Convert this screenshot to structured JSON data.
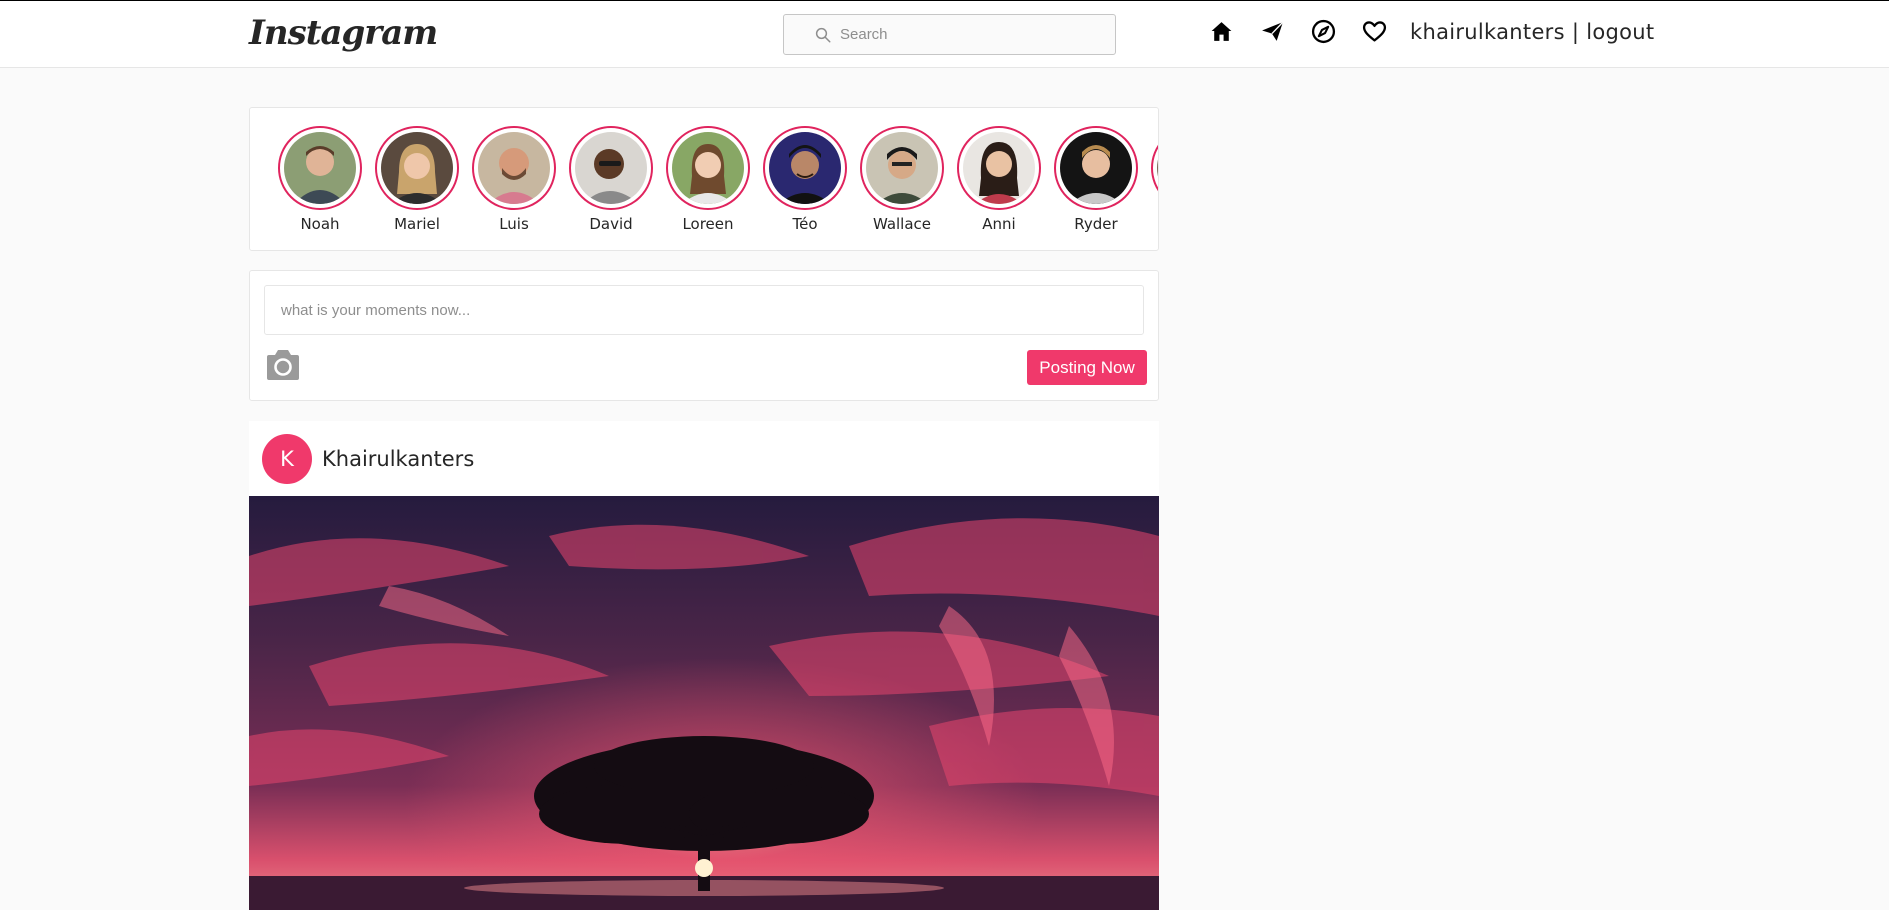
{
  "header": {
    "logo_text": "Instagram",
    "search_placeholder": "Search",
    "username": "khairulkanters",
    "separator": " | ",
    "logout_label": "logout",
    "icons": [
      "home-icon",
      "send-icon",
      "explore-icon",
      "heart-icon"
    ]
  },
  "stories": [
    {
      "name": "Noah"
    },
    {
      "name": "Mariel"
    },
    {
      "name": "Luis"
    },
    {
      "name": "David"
    },
    {
      "name": "Loreen"
    },
    {
      "name": "Téo"
    },
    {
      "name": "Wallace"
    },
    {
      "name": "Anni"
    },
    {
      "name": "Ryder"
    }
  ],
  "composer": {
    "placeholder": "what is your moments now...",
    "post_button": "Posting Now"
  },
  "post": {
    "avatar_initial": "K",
    "author": "Khairulkanters"
  },
  "colors": {
    "accent": "#f0396b",
    "story_ring": "#e0245e",
    "background": "#fafafa"
  }
}
